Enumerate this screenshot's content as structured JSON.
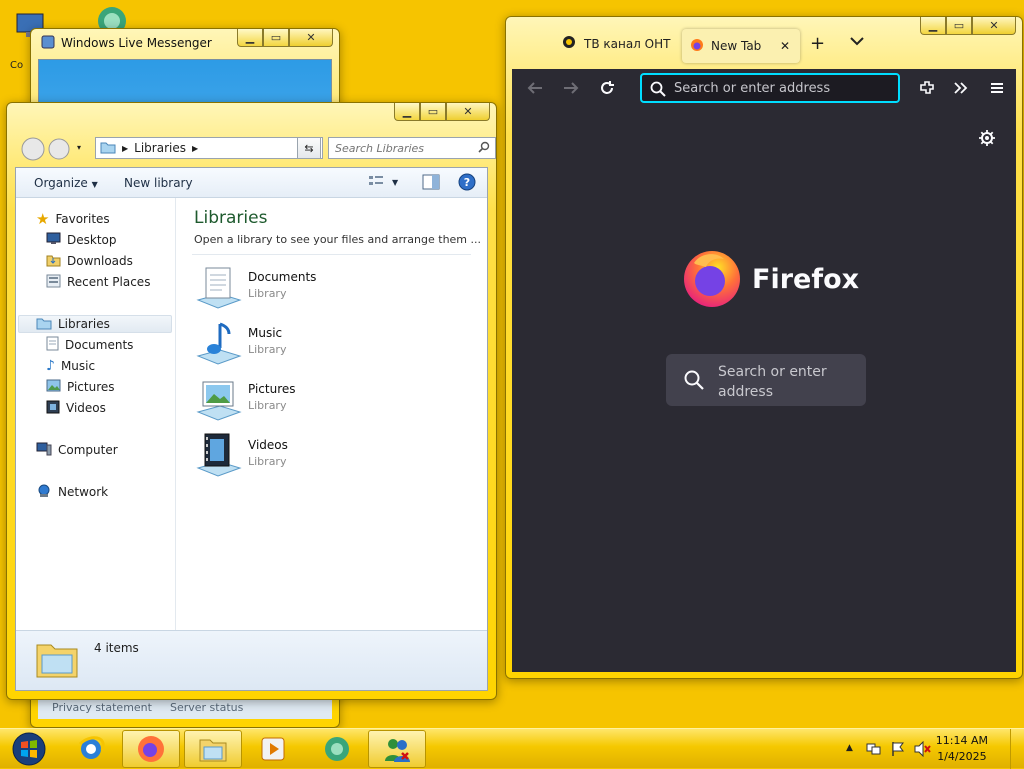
{
  "desktop": {
    "computer_icon_label_partial": "Co"
  },
  "messenger": {
    "title": "Windows Live Messenger",
    "footer_links": [
      "Privacy statement",
      "Server status"
    ]
  },
  "explorer": {
    "breadcrumb": "Libraries",
    "search_placeholder": "Search Libraries",
    "toolbar": {
      "organize": "Organize",
      "new_library": "New library"
    },
    "nav": {
      "favorites": "Favorites",
      "favorites_items": [
        "Desktop",
        "Downloads",
        "Recent Places"
      ],
      "libraries": "Libraries",
      "libraries_items": [
        "Documents",
        "Music",
        "Pictures",
        "Videos"
      ],
      "computer": "Computer",
      "network": "Network"
    },
    "main": {
      "title": "Libraries",
      "subtitle": "Open a library to see your files and arrange them ...",
      "items": [
        {
          "name": "Documents",
          "type": "Library"
        },
        {
          "name": "Music",
          "type": "Library"
        },
        {
          "name": "Pictures",
          "type": "Library"
        },
        {
          "name": "Videos",
          "type": "Library"
        }
      ]
    },
    "status": {
      "count": "4 items"
    }
  },
  "firefox": {
    "tabs": [
      {
        "label": "ТВ канал ОНТ"
      },
      {
        "label": "New Tab"
      }
    ],
    "url_placeholder": "Search or enter address",
    "brand": "Firefox",
    "content_search_placeholder": "Search or enter address"
  },
  "taskbar": {
    "time": "11:14 AM",
    "date": "1/4/2025"
  },
  "colors": {
    "desktop_bg": "#f6c400",
    "ff_dark": "#2b2a33",
    "ff_accent": "#00ddff",
    "library_title": "#1e5a2e"
  }
}
